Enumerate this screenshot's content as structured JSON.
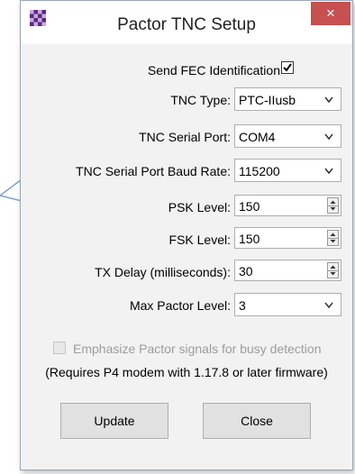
{
  "window": {
    "title": "Pactor TNC Setup",
    "close_glyph": "×",
    "app_icon": "checkered-app-icon"
  },
  "fec": {
    "label": "Send FEC Identification",
    "checked": true
  },
  "fields": {
    "tnc_type": {
      "label": "TNC Type:",
      "value": "PTC-IIusb"
    },
    "serial_port": {
      "label": "TNC Serial Port:",
      "value": "COM4"
    },
    "baud_rate": {
      "label": "TNC Serial Port Baud Rate:",
      "value": "115200"
    },
    "psk_level": {
      "label": "PSK Level:",
      "value": "150"
    },
    "fsk_level": {
      "label": "FSK Level:",
      "value": "150"
    },
    "tx_delay": {
      "label": "TX Delay (milliseconds):",
      "value": "30"
    },
    "max_pactor": {
      "label": "Max Pactor Level:",
      "value": "3"
    }
  },
  "emphasize": {
    "label": "Emphasize Pactor signals for busy detection",
    "checked": false,
    "enabled": false
  },
  "note": "(Requires P4 modem with 1.17.8 or later firmware)",
  "buttons": {
    "update": "Update",
    "close": "Close"
  },
  "colors": {
    "close_button": "#c75050",
    "dialog_bg": "#f2f2f2",
    "callout_border": "#7f9fcf"
  }
}
